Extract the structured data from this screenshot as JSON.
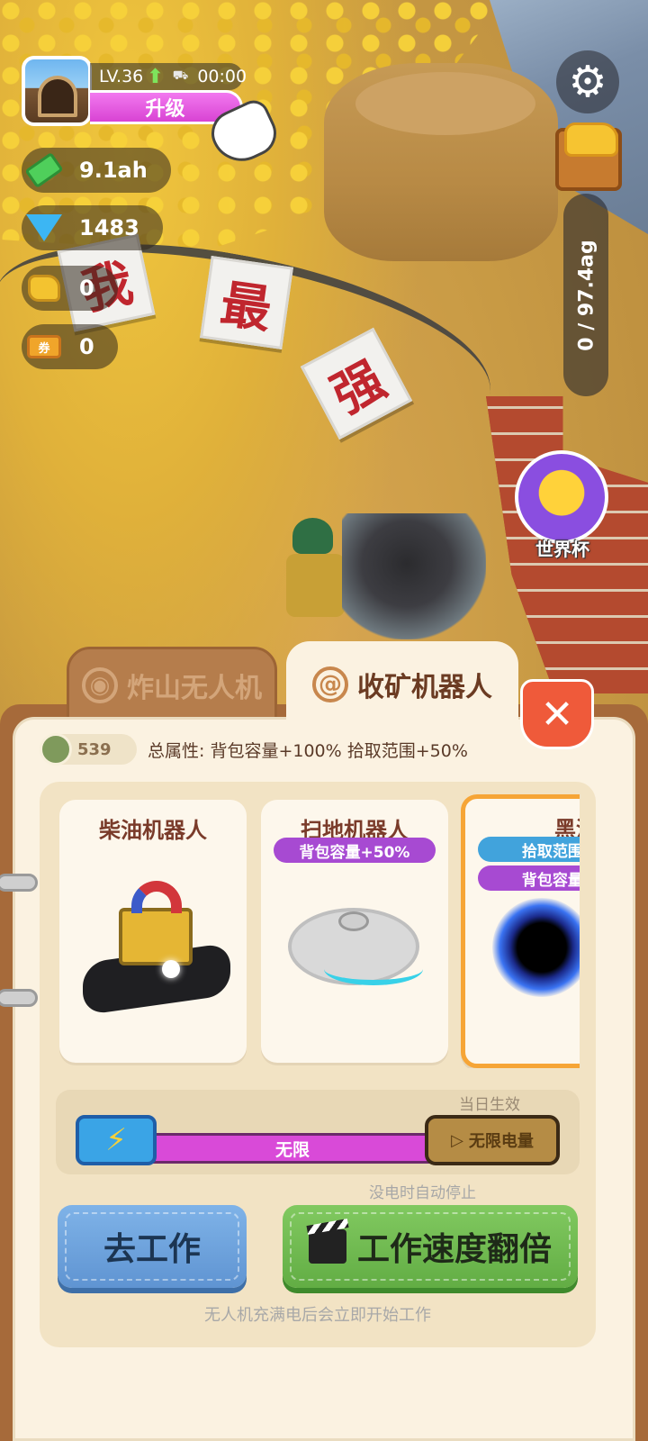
{
  "hud": {
    "level": "LV.36",
    "timer": "00:00",
    "upgrade_label": "升级",
    "resources": [
      {
        "icon": "cash-icon",
        "value": "9.1ah"
      },
      {
        "icon": "diamond-icon",
        "value": "1483"
      },
      {
        "icon": "gold-ore-icon",
        "value": "0"
      },
      {
        "icon": "ticket-icon",
        "value": "0",
        "icon_text": "券"
      }
    ],
    "capacity": "0 / 97.4ag",
    "world_cup_label": "世界杯"
  },
  "scene": {
    "sign_chars": [
      "我",
      "最",
      "强"
    ]
  },
  "panel": {
    "tabs": [
      {
        "label": "炸山无人机",
        "active": false
      },
      {
        "label": "收矿机器人",
        "active": true
      }
    ],
    "points": "539",
    "total_attributes": "总属性:  背包容量+100%  拾取范围+50%",
    "robots": [
      {
        "name": "柴油机器人",
        "tags": []
      },
      {
        "name": "扫地机器人",
        "tags": [
          "背包容量+50%"
        ]
      },
      {
        "name": "黑洞",
        "tags": [
          "拾取范围+",
          "背包容量+"
        ],
        "selected": true
      }
    ],
    "effect_label": "当日生效",
    "energy_value": "无限",
    "unlimited_power_label": "无限电量",
    "auto_stop_note": "没电时自动停止",
    "go_work_label": "去工作",
    "double_speed_label": "工作速度翻倍",
    "bottom_note": "无人机充满电后会立即开始工作"
  },
  "colors": {
    "accent_purple": "#d94ad8",
    "close_red": "#ef5a3a",
    "work_blue": "#6fa3de",
    "speed_green": "#72bb52"
  }
}
